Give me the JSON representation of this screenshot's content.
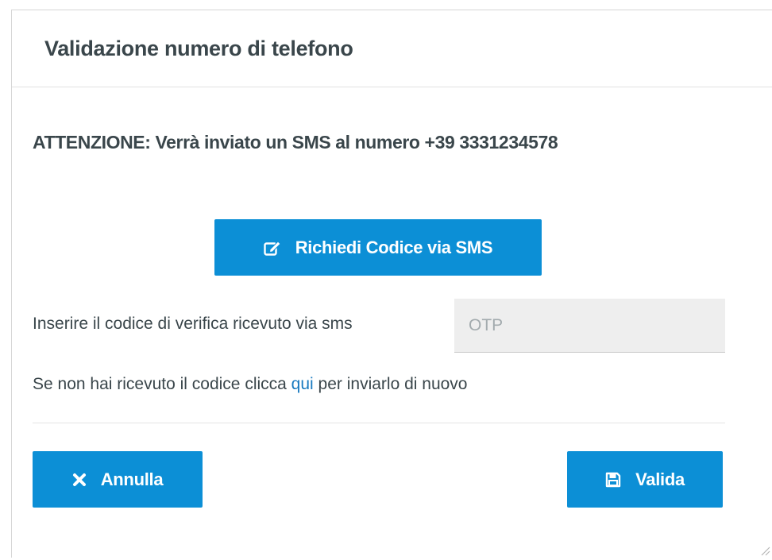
{
  "dialog": {
    "title": "Validazione numero di telefono",
    "warning": "ATTENZIONE: Verrà inviato un SMS al numero +39 3331234578",
    "request_button": {
      "label": "Richiedi Codice via SMS",
      "icon": "edit-icon"
    },
    "otp": {
      "label": "Inserire il codice di verifica ricevuto via sms",
      "placeholder": "OTP",
      "value": ""
    },
    "resend": {
      "prefix": "Se non hai ricevuto il codice clicca ",
      "link": "qui",
      "suffix": " per inviarlo di nuovo"
    },
    "footer": {
      "cancel_label": "Annulla",
      "cancel_icon": "close-icon",
      "validate_label": "Valida",
      "validate_icon": "save-icon"
    }
  },
  "colors": {
    "primary": "#0c8fd6",
    "link": "#1a7bc0",
    "text": "#3a464b",
    "input_bg": "#eeeeee"
  }
}
